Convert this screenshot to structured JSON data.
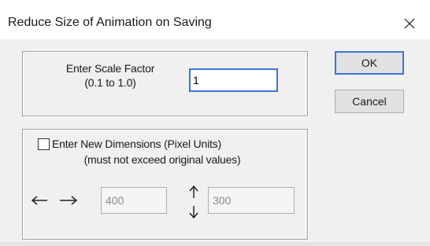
{
  "window": {
    "title": "Reduce Size of Animation on Saving",
    "close_glyph": "✕"
  },
  "scale": {
    "label_line1": "Enter Scale Factor",
    "label_line2": "(0.1  to  1.0)",
    "value": "1"
  },
  "buttons": {
    "ok_label": "OK",
    "cancel_label": "Cancel"
  },
  "dimensions": {
    "checkbox_checked": false,
    "label_line1": "Enter New Dimensions (Pixel Units)",
    "label_line2": "(must not exceed original values)",
    "width_value": "400",
    "height_value": "300"
  },
  "icons": {
    "close": "close-icon",
    "horizontal_arrow": "horizontal-arrow-icon",
    "vertical_arrow": "vertical-arrow-icon"
  },
  "colors": {
    "accent": "#3b74d8",
    "dialog_bg": "#f0f0f0",
    "button_bg": "#e1e1e1"
  }
}
